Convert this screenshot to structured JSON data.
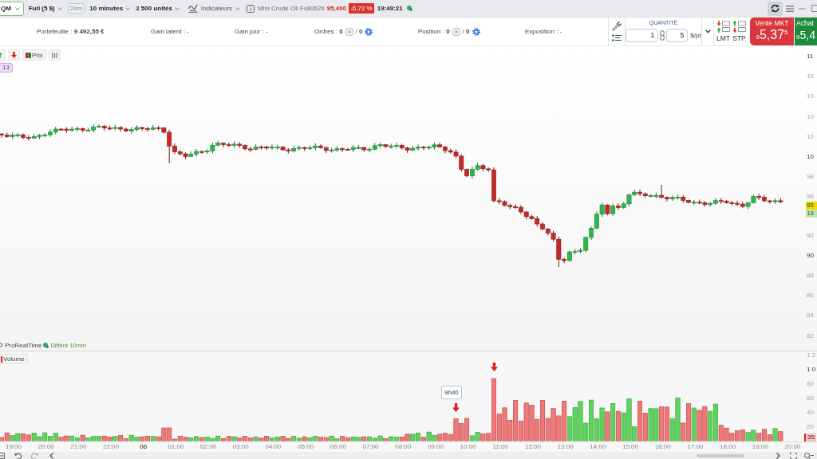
{
  "toolbar": {
    "symbol": "QM",
    "contract": "Full (5 $)",
    "interval_short": "20m",
    "interval": "10 minutes",
    "size": "2 500 unités",
    "indicators": "Indicateurs",
    "instrument": "Mini Crude Oil Full0626",
    "last_price": "95,400",
    "change": "-6,72 %",
    "time": "19:49:21"
  },
  "account": {
    "portfolio": "Portefeuille : **9 492,55 €**",
    "unrealized": "Gain latent : -",
    "daily_gain": "Gain jour : -",
    "orders": {
      "label": "Ordres : **0**",
      "total": "/ **0**"
    },
    "position": {
      "label": "Position : **0**",
      "total": "/ **0**"
    },
    "exposure": "Exposition : -"
  },
  "ticket": {
    "quantity_label": "QUANTITÉ",
    "quantity": "1",
    "multiplier": "5",
    "unit": "$/pt",
    "order_types": [
      {
        "label": "LMT",
        "kind": "limit"
      },
      {
        "label": "STP",
        "kind": "stop"
      }
    ],
    "sell": {
      "label": "Vente MKT",
      "price": "$_{9}$5,37$^{5}$"
    },
    "buy": {
      "label": "Achat",
      "price": "$_{9}$5,4"
    }
  },
  "chart": {
    "series_label": "Prix",
    "tag": "13",
    "source": "ProRealTime",
    "feed": "Différé 10min",
    "price_axis": {
      "upper": [
        {
          "text": "11",
          "major": true
        },
        {
          "text": "10",
          "major": false
        },
        {
          "text": "10",
          "major": false
        },
        {
          "text": "10",
          "major": false
        },
        {
          "text": "10",
          "major": false
        },
        {
          "text": "10",
          "major": true
        },
        {
          "text": "98",
          "major": false
        },
        {
          "text": "96",
          "major": false
        }
      ],
      "lower": [
        {
          "text": "92",
          "major": false
        },
        {
          "text": "90",
          "major": true
        },
        {
          "text": "88",
          "major": false
        },
        {
          "text": "86",
          "major": false
        },
        {
          "text": "84",
          "major": false
        },
        {
          "text": "82",
          "major": false
        }
      ],
      "last_price": "95",
      "countdown": "18"
    }
  },
  "volume": {
    "label": "Volume",
    "callout": "9h40",
    "axis": {
      "labels": [
        {
          "text": "1 2",
          "major": false
        },
        {
          "text": "1 0",
          "major": true
        },
        {
          "text": "80",
          "major": false
        },
        {
          "text": "60",
          "major": false
        },
        {
          "text": "40",
          "major": false
        },
        {
          "text": "20",
          "major": false
        }
      ],
      "last_value": "35"
    }
  },
  "time_axis": [
    {
      "text": "19:00",
      "major": false
    },
    {
      "text": "20:00",
      "major": false
    },
    {
      "text": "21:00",
      "major": false
    },
    {
      "text": "22:00",
      "major": false
    },
    {
      "text": "06",
      "major": true
    },
    {
      "text": "01:00",
      "major": false
    },
    {
      "text": "02:00",
      "major": false
    },
    {
      "text": "03:00",
      "major": false
    },
    {
      "text": "04:00",
      "major": false
    },
    {
      "text": "05:00",
      "major": false
    },
    {
      "text": "06:00",
      "major": false
    },
    {
      "text": "07:00",
      "major": false
    },
    {
      "text": "08:00",
      "major": false
    },
    {
      "text": "09:00",
      "major": false
    },
    {
      "text": "10:00",
      "major": false
    },
    {
      "text": "11:00",
      "major": false
    },
    {
      "text": "12:00",
      "major": false
    },
    {
      "text": "13:00",
      "major": false
    },
    {
      "text": "14:00",
      "major": false
    },
    {
      "text": "15:00",
      "major": false
    },
    {
      "text": "16:00",
      "major": false
    },
    {
      "text": "17:00",
      "major": false
    },
    {
      "text": "18:00",
      "major": false
    },
    {
      "text": "19:00",
      "major": false
    },
    {
      "text": "20:00",
      "major": false
    }
  ]
}
